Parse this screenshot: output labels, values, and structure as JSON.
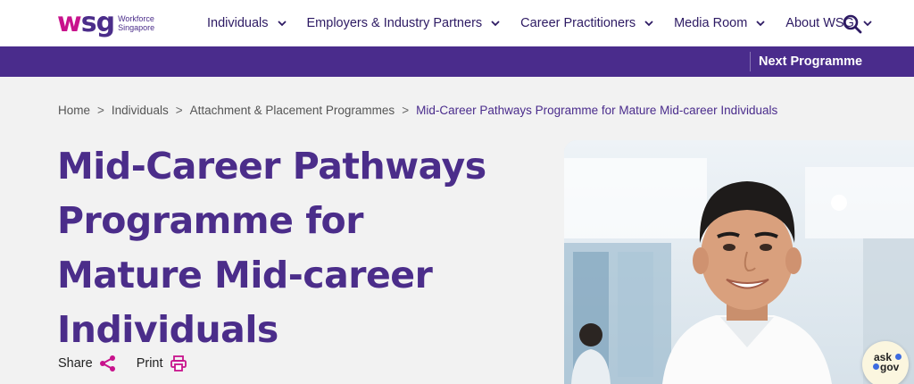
{
  "header": {
    "logo": {
      "mark_w": "w",
      "mark_sg": "sg",
      "text_line1": "Workforce",
      "text_line2": "Singapore"
    },
    "nav": [
      {
        "label": "Individuals"
      },
      {
        "label": "Employers & Industry Partners"
      },
      {
        "label": "Career Practitioners"
      },
      {
        "label": "Media Room"
      },
      {
        "label": "About WSG"
      }
    ],
    "search_icon": "search-icon"
  },
  "subbar": {
    "next_label": "Next Programme"
  },
  "breadcrumb": {
    "separator": ">",
    "items": [
      "Home",
      "Individuals",
      "Attachment & Placement Programmes"
    ],
    "current": "Mid-Career Pathways Programme for Mature Mid-career Individuals"
  },
  "page": {
    "title_lines": [
      "Mid-Career Pathways",
      "Programme for",
      "Mature Mid-career",
      "Individuals"
    ]
  },
  "actions": {
    "share_label": "Share",
    "share_icon": "share-icon",
    "print_label": "Print",
    "print_icon": "printer-icon"
  },
  "askgov": {
    "line1": "ask",
    "line2": "gov"
  },
  "colors": {
    "brand_purple": "#4a2c8c",
    "brand_magenta": "#c8138c",
    "background": "#f2f2f2"
  }
}
